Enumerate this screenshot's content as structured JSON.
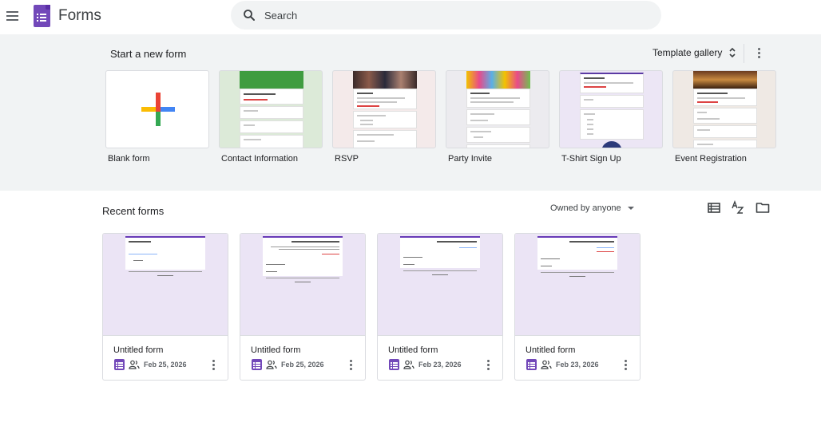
{
  "header": {
    "app_name": "Forms",
    "search_placeholder": "Search"
  },
  "templates": {
    "heading": "Start a new form",
    "gallery_label": "Template gallery",
    "items": [
      {
        "label": "Blank form"
      },
      {
        "label": "Contact Information"
      },
      {
        "label": "RSVP"
      },
      {
        "label": "Party Invite"
      },
      {
        "label": "T-Shirt Sign Up"
      },
      {
        "label": "Event Registration"
      }
    ]
  },
  "recent": {
    "heading": "Recent forms",
    "owner_filter": "Owned by anyone",
    "forms": [
      {
        "title": "Untitled form",
        "date": "Feb 25, 2026"
      },
      {
        "title": "Untitled form",
        "date": "Feb 25, 2026"
      },
      {
        "title": "Untitled form",
        "date": "Feb 23, 2026"
      },
      {
        "title": "Untitled form",
        "date": "Feb 23, 2026"
      }
    ]
  },
  "colors": {
    "brand_purple": "#7248b9",
    "section_bg": "#f1f3f4",
    "preview_bg": "#ebe4f5"
  },
  "icons": [
    "hamburger-menu-icon",
    "forms-logo-icon",
    "search-icon",
    "unfold-icon",
    "more-vert-icon",
    "list-view-icon",
    "sort-az-icon",
    "folder-icon",
    "shared-people-icon"
  ]
}
